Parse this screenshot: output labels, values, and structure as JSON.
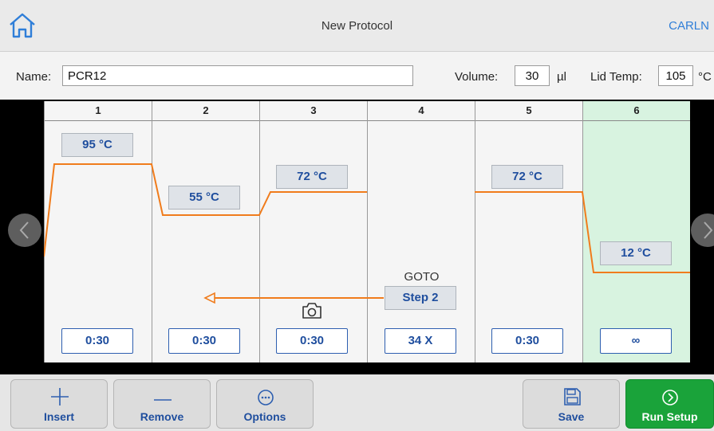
{
  "header": {
    "title": "New Protocol",
    "user": "CARLN",
    "home_icon": "home-icon"
  },
  "settings": {
    "name_label": "Name:",
    "name_value": "PCR12",
    "volume_label": "Volume:",
    "volume_value": "30",
    "volume_unit": "µl",
    "lid_label": "Lid Temp:",
    "lid_value": "105",
    "lid_unit": "°C"
  },
  "steps": [
    {
      "num": "1",
      "temp": "95 °C",
      "time": "0:30"
    },
    {
      "num": "2",
      "temp": "55 °C",
      "time": "0:30"
    },
    {
      "num": "3",
      "temp": "72 °C",
      "time": "0:30"
    },
    {
      "num": "4",
      "goto_label": "GOTO",
      "goto_target": "Step 2",
      "cycles": "34 X"
    },
    {
      "num": "5",
      "temp": "72 °C",
      "time": "0:30"
    },
    {
      "num": "6",
      "temp": "12 °C",
      "time": "∞"
    }
  ],
  "toolbar": {
    "insert": "Insert",
    "remove": "Remove",
    "options": "Options",
    "save": "Save",
    "run_setup": "Run Setup"
  },
  "colors": {
    "accent": "#2e5fb0",
    "profile_line": "#f07c1c",
    "hold_bg": "#d8f3e0",
    "run_green": "#1aa33a"
  }
}
